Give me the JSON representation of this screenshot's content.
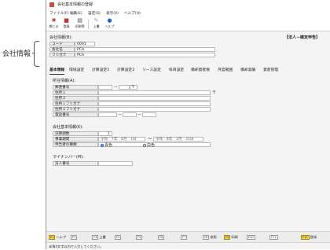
{
  "callout": {
    "label": "会社情報"
  },
  "window": {
    "title": "会社基本情報の登録"
  },
  "menu": {
    "items": [
      "ファイル(F)",
      "編集(E)",
      "設定(S)",
      "表示(V)",
      "ヘルプ(H)"
    ]
  },
  "toolbar": {
    "close": "閉じる",
    "register": "登録",
    "print": "印刷等",
    "upper": "上書",
    "help": "ヘルプ"
  },
  "company": {
    "section_title": "会社情報(B):",
    "mode_label": "【法人－確定申告】",
    "code_label": "コード",
    "code_value": "0001",
    "name_label": "会社名",
    "name_value": "PCA",
    "kana_label": "フリガナ",
    "kana_value": "PCA"
  },
  "tabs": [
    "基本情報",
    "環境設定",
    "計算設定1",
    "計算設定2",
    "リース設定",
    "科目設定",
    "償却資産税",
    "月度範囲",
    "償却実績",
    "資産管理"
  ],
  "address": {
    "section_title": "所在情報(A):",
    "postal_label": "郵便番号",
    "postal_dash": "－",
    "postal_icon": "〒",
    "addr1_label": "住所１",
    "addr1_icon": "〒",
    "addr2_label": "住所２",
    "addr1_kana_label": "住所１フリガナ",
    "addr2_kana_label": "住所２フリガナ",
    "phone_label": "電話番号",
    "phone_dash": "－"
  },
  "basic": {
    "section_title": "会社基本情報(K):",
    "fiscal_label": "決算期数",
    "fiscal_value": "1",
    "period_label": "事業期間",
    "period_start": "令和　7年　4月　1日",
    "period_sep": "～",
    "period_end": "令和　8年　3月　31日",
    "filing_label": "申告者の種類",
    "filing_blue": "青色",
    "filing_white": "白色"
  },
  "mynumber": {
    "section_title": "マイナンバー(M):",
    "corp_label": "法人番号"
  },
  "fkeys": [
    {
      "key": "F1",
      "label": "ヘルプ",
      "on": true
    },
    {
      "key": "F2",
      "label": "",
      "on": false
    },
    {
      "key": "F3",
      "label": "上書",
      "on": false
    },
    {
      "key": "F4",
      "label": "",
      "on": false
    },
    {
      "key": "F5",
      "label": "",
      "on": false
    },
    {
      "key": "F6",
      "label": "",
      "on": false
    },
    {
      "key": "F7",
      "label": "",
      "on": false
    },
    {
      "key": "F8",
      "label": "参照",
      "on": false
    },
    {
      "key": "F9",
      "label": "印刷",
      "on": true
    },
    {
      "key": "F10",
      "label": "",
      "on": false
    },
    {
      "key": "F11",
      "label": "",
      "on": false
    },
    {
      "key": "F12",
      "label": "登録",
      "on": true
    }
  ],
  "status": {
    "text": "半角4文字以内で入力してください。"
  }
}
